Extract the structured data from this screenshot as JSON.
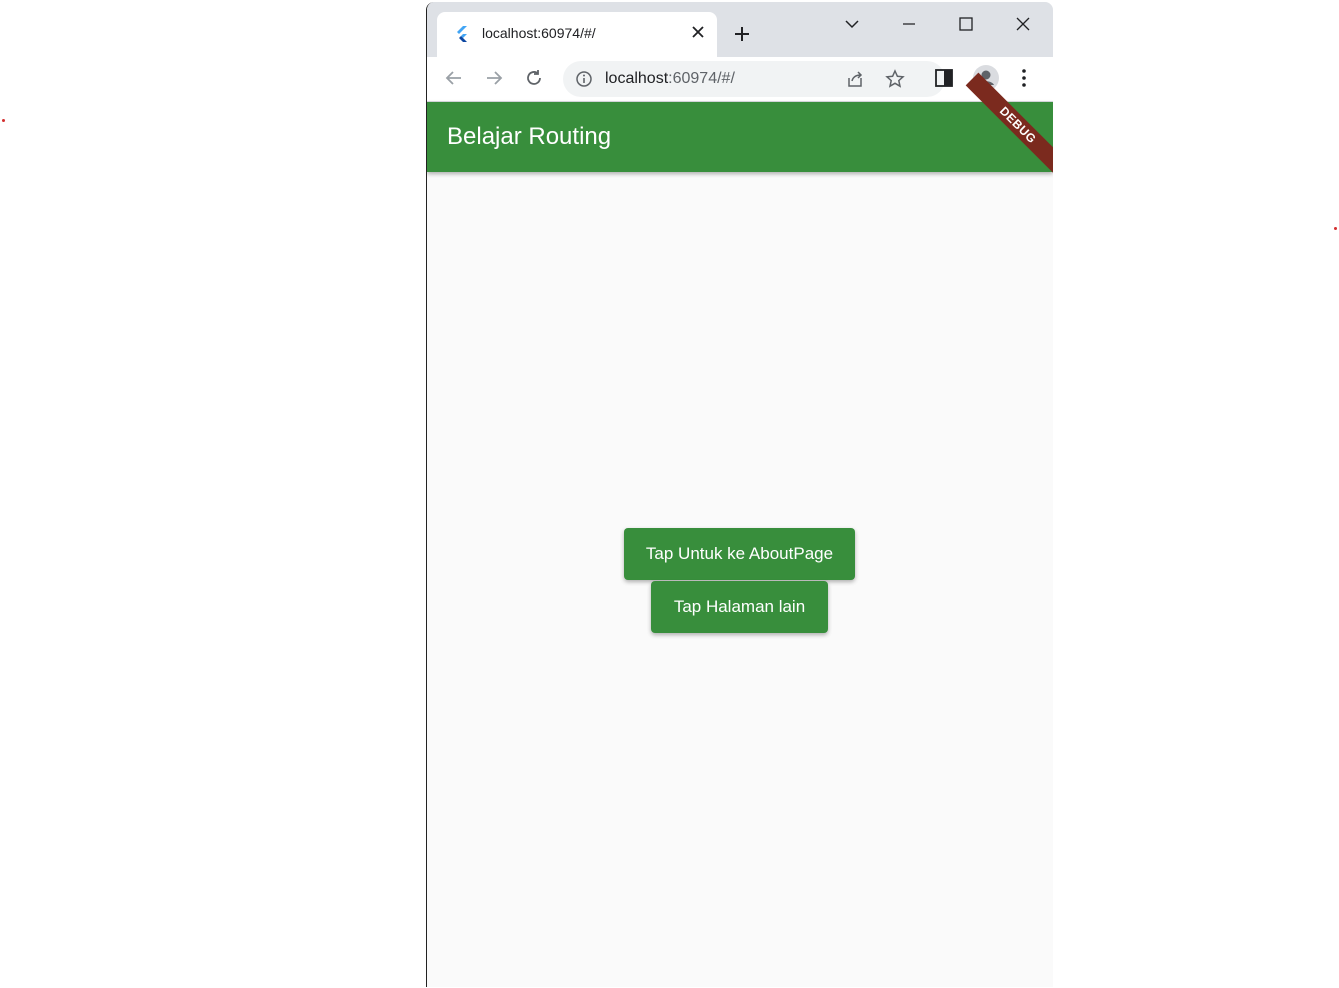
{
  "browser": {
    "tab_title": "localhost:60974/#/",
    "url_host": "localhost",
    "url_rest": ":60974/#/"
  },
  "app": {
    "title": "Belajar Routing",
    "debug_banner": "DEBUG",
    "primary_color": "#388e3c",
    "buttons": {
      "about": "Tap Untuk ke AboutPage",
      "other": "Tap Halaman lain"
    }
  },
  "icons": {
    "tab": [
      "flutter-favicon-icon",
      "close-icon",
      "plus-icon"
    ],
    "window": [
      "chevron-down-icon",
      "minimize-icon",
      "maximize-icon",
      "close-window-icon"
    ],
    "toolbar": [
      "back-arrow-icon",
      "forward-arrow-icon",
      "reload-icon",
      "info-icon",
      "share-icon",
      "star-icon",
      "side-panel-icon",
      "profile-icon",
      "kebab-menu-icon"
    ]
  }
}
